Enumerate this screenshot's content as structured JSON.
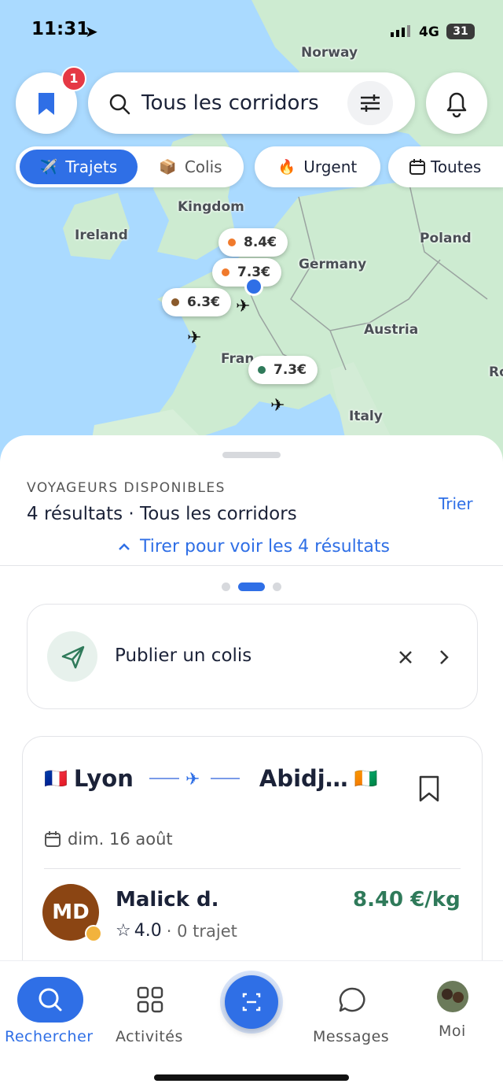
{
  "status_bar": {
    "time": "11:31",
    "network": "4G",
    "battery": "31"
  },
  "map": {
    "countries": [
      "Norway",
      "Kingdom",
      "Ireland",
      "Poland",
      "Germany",
      "Austria",
      "Fran",
      "Italy",
      "Ro"
    ],
    "prices": [
      "8.4€",
      "7.3€",
      "6.3€",
      "7.3€"
    ],
    "colors": {
      "water": "#aadaff",
      "land": "#cdebd1",
      "orange": "#f07a2c",
      "brown": "#8a5a2b",
      "green": "#2f7a5a"
    }
  },
  "header": {
    "saved_badge": "1",
    "search_label": "Tous les corridors"
  },
  "filters": {
    "segment": [
      {
        "label": "Trajets",
        "emoji": "✈️",
        "active": true
      },
      {
        "label": "Colis",
        "emoji": "📦",
        "active": false
      }
    ],
    "urgent": {
      "label": "Urgent",
      "emoji": "🔥"
    },
    "date": {
      "label": "Toutes"
    }
  },
  "sheet": {
    "section_title": "VOYAGEURS DISPONIBLES",
    "results_count": "4 résultats",
    "results_scope": "Tous les corridors",
    "sort_label": "Trier",
    "pull_hint": "Tirer pour voir les 4 résultats"
  },
  "publish": {
    "label": "Publier un colis"
  },
  "trip": {
    "origin_flag": "🇫🇷",
    "origin": "Lyon",
    "destination": "Abidj…",
    "destination_flag": "🇨🇮",
    "date": "dim. 16 août",
    "traveler": {
      "initials": "MD",
      "name": "Malick d.",
      "rating": "4.0",
      "trips": "· 0 trajet",
      "price": "8.40 €/kg"
    }
  },
  "nav": {
    "items": [
      {
        "label": "Rechercher",
        "active": true
      },
      {
        "label": "Activités",
        "active": false
      },
      {
        "label": "Messages",
        "active": false
      },
      {
        "label": "Moi",
        "active": false
      }
    ]
  },
  "colors": {
    "accent": "#2f6fe6",
    "price_green": "#2f7a5a",
    "avatar": "#8b4513",
    "text_dark": "#1b2238"
  }
}
